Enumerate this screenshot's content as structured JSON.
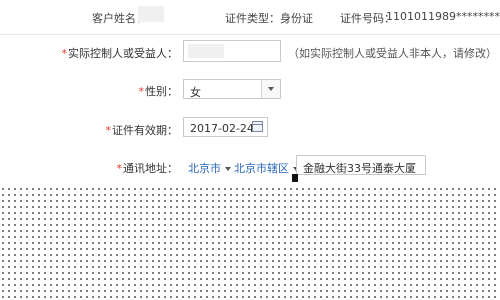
{
  "header": {
    "customer_name_label": "客户姓名：",
    "id_type_label": "证件类型：",
    "id_type_value": "身份证",
    "id_number_label": "证件号码：",
    "id_number_value": "1101011989********"
  },
  "form": {
    "controller": {
      "required_mark": "*",
      "label": "实际控制人或受益人：",
      "hint": "（如实际控制人或受益人非本人，请修改）"
    },
    "gender": {
      "required_mark": "*",
      "label": "性别：",
      "value": "女"
    },
    "id_validity": {
      "required_mark": "*",
      "label": "证件有效期：",
      "value": "2017-02-24"
    },
    "address": {
      "required_mark": "*",
      "label": "通讯地址：",
      "city": "北京市",
      "district": "北京市辖区",
      "detail": "金融大街33号通泰大厦"
    }
  }
}
